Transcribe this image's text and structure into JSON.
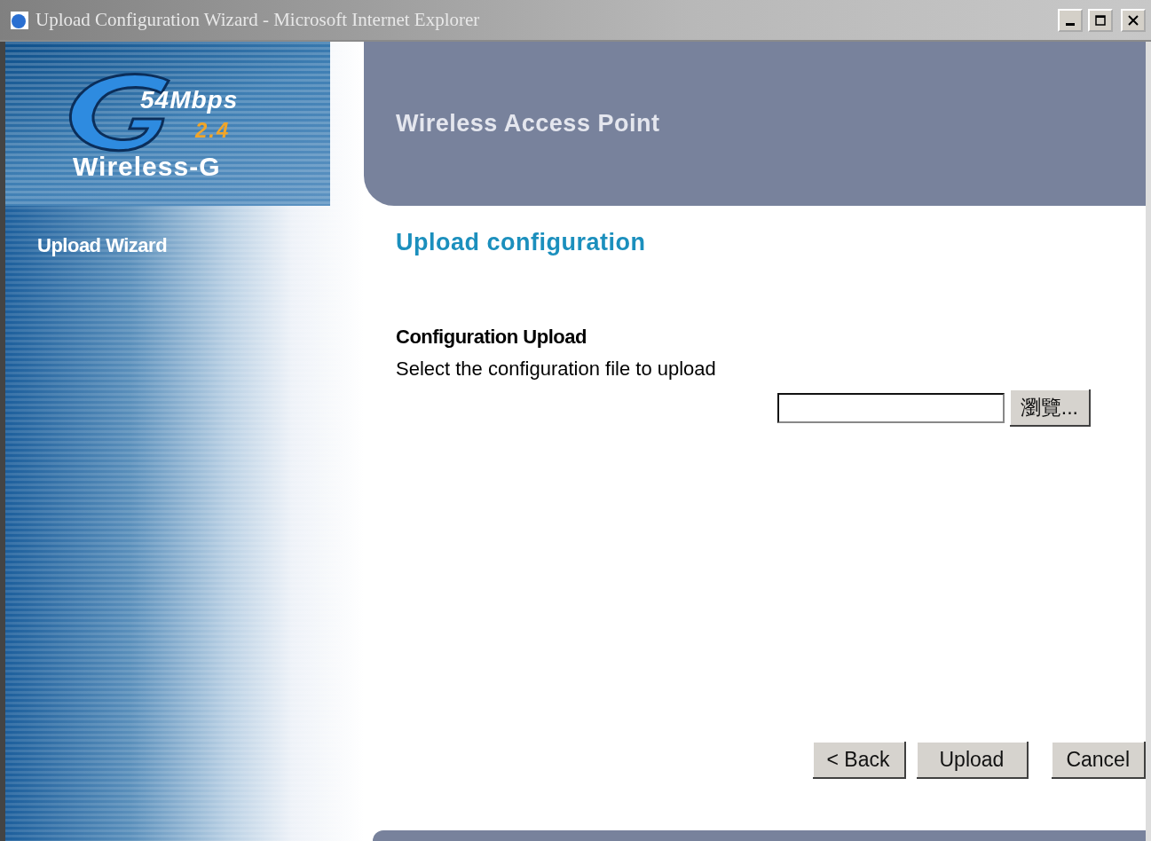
{
  "window": {
    "title": "Upload Configuration Wizard - Microsoft Internet Explorer"
  },
  "logo": {
    "speed": "54Mbps",
    "band": "2.4",
    "name": "Wireless-G"
  },
  "header": {
    "title": "Wireless Access Point"
  },
  "sidebar": {
    "title": "Upload Wizard"
  },
  "page": {
    "heading": "Upload configuration",
    "section": "Configuration Upload",
    "instruction": "Select the configuration file to upload",
    "browse_button": "瀏覽..."
  },
  "buttons": [
    "< Back",
    "Upload",
    "Cancel"
  ]
}
